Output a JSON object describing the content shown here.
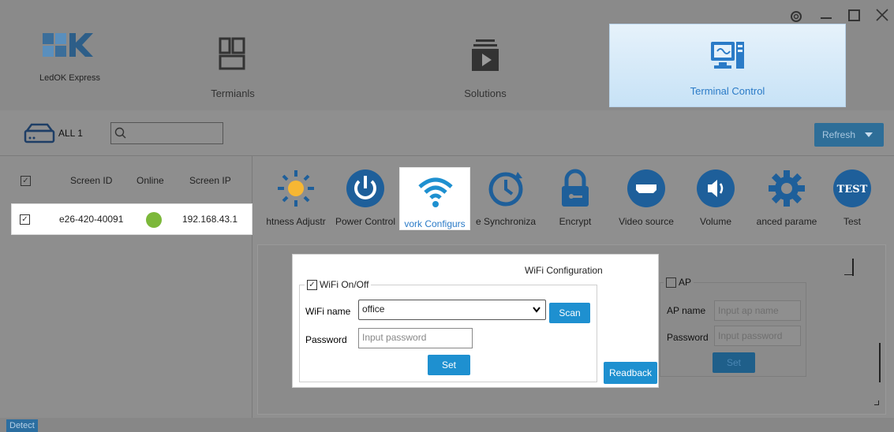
{
  "app": {
    "logo_text": "LedOK Express"
  },
  "nav": {
    "terminals": "Termianls",
    "solutions": "Solutions",
    "terminal_control": "Terminal Control"
  },
  "toolbar": {
    "all_label": "ALL 1",
    "search_placeholder": "",
    "refresh_label": "Refresh"
  },
  "table": {
    "headers": {
      "screen_id": "Screen ID",
      "online": "Online",
      "screen_ip": "Screen IP"
    },
    "rows": [
      {
        "screen_id": "e26-420-40091",
        "online": true,
        "screen_ip": "192.168.43.1"
      }
    ]
  },
  "functions": [
    {
      "label": "htness Adjustr",
      "icon": "brightness-icon"
    },
    {
      "label": "Power Control",
      "icon": "power-icon"
    },
    {
      "label": "vork Configurs",
      "icon": "wifi-icon",
      "active": true
    },
    {
      "label": "e Synchroniza",
      "icon": "clock-sync-icon"
    },
    {
      "label": "Encrypt",
      "icon": "lock-icon"
    },
    {
      "label": "Video source",
      "icon": "hdmi-icon"
    },
    {
      "label": "Volume",
      "icon": "volume-icon"
    },
    {
      "label": "anced parame",
      "icon": "gear-icon"
    },
    {
      "label": "Test",
      "icon": "test-icon"
    }
  ],
  "wifi": {
    "title": "WiFi Configuration",
    "onoff_label": "WiFi On/Off",
    "name_label": "WiFi name",
    "name_value": "office",
    "scan_label": "Scan",
    "password_label": "Password",
    "password_placeholder": "Input password",
    "set_label": "Set",
    "readback_label": "Readback"
  },
  "ap": {
    "label": "AP",
    "name_label": "AP name",
    "name_placeholder": "Input ap name",
    "password_label": "Password",
    "password_placeholder": "Input password",
    "set_label": "Set"
  },
  "status": {
    "detect_label": "Detect"
  },
  "colors": {
    "accent": "#1e90d0",
    "online": "#7cb83a",
    "nav_active_text": "#2b7bc7"
  }
}
